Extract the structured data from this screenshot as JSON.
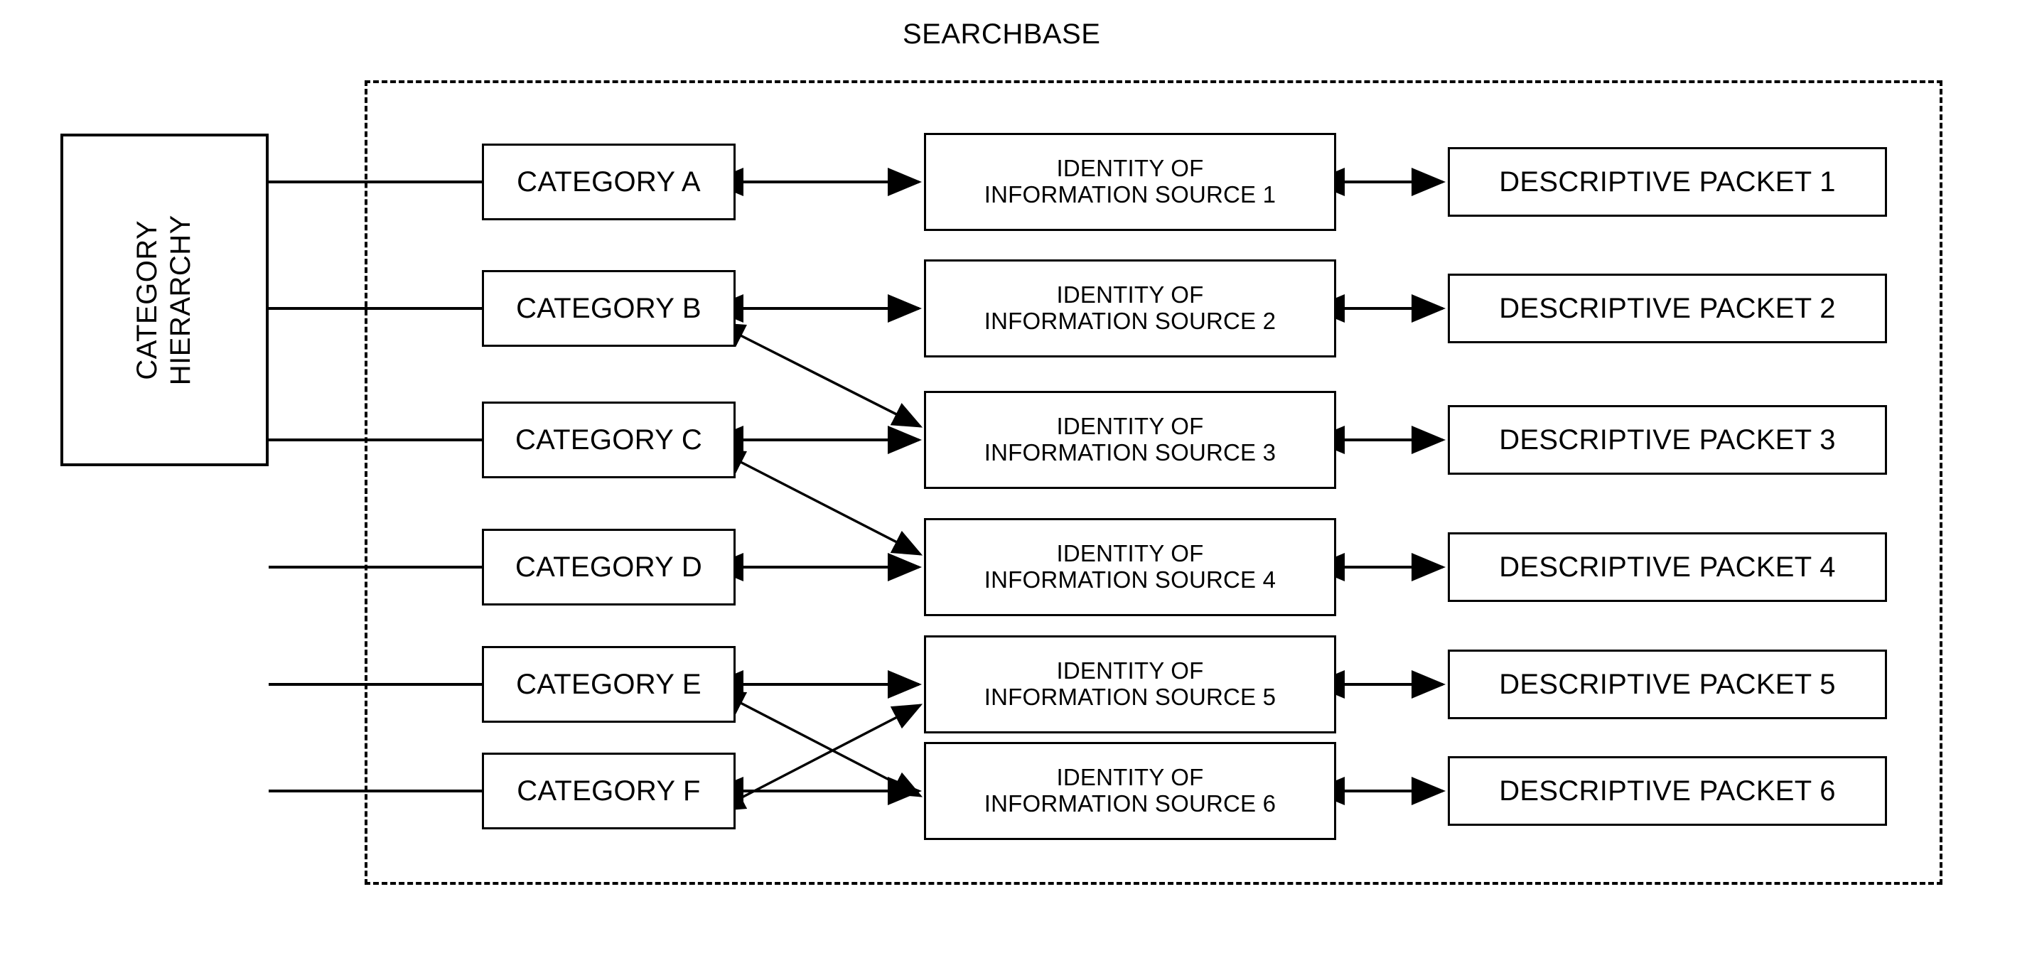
{
  "diagram": {
    "title": "SEARCHBASE",
    "hierarchy_box": {
      "label_line1": "CATEGORY",
      "label_line2": "HIERARCHY"
    },
    "categories": [
      {
        "label": "CATEGORY A"
      },
      {
        "label": "CATEGORY B"
      },
      {
        "label": "CATEGORY C"
      },
      {
        "label": "CATEGORY D"
      },
      {
        "label": "CATEGORY E"
      },
      {
        "label": "CATEGORY F"
      }
    ],
    "information_sources": [
      {
        "line1": "IDENTITY OF",
        "line2": "INFORMATION SOURCE 1"
      },
      {
        "line1": "IDENTITY OF",
        "line2": "INFORMATION SOURCE 2"
      },
      {
        "line1": "IDENTITY OF",
        "line2": "INFORMATION SOURCE 3"
      },
      {
        "line1": "IDENTITY OF",
        "line2": "INFORMATION SOURCE 4"
      },
      {
        "line1": "IDENTITY OF",
        "line2": "INFORMATION SOURCE 5"
      },
      {
        "line1": "IDENTITY OF",
        "line2": "INFORMATION SOURCE 6"
      }
    ],
    "descriptive_packets": [
      {
        "label": "DESCRIPTIVE PACKET 1"
      },
      {
        "label": "DESCRIPTIVE PACKET 2"
      },
      {
        "label": "DESCRIPTIVE PACKET 3"
      },
      {
        "label": "DESCRIPTIVE PACKET 4"
      },
      {
        "label": "DESCRIPTIVE PACKET 5"
      },
      {
        "label": "DESCRIPTIVE PACKET 6"
      }
    ],
    "colors": {
      "stroke": "#000000",
      "background": "#ffffff"
    },
    "connections": {
      "hierarchy_to_category": [
        "CATEGORY A",
        "CATEGORY B",
        "CATEGORY C",
        "CATEGORY D",
        "CATEGORY E",
        "CATEGORY F"
      ],
      "category_to_source_horizontal": [
        [
          "CATEGORY A",
          "IDENTITY OF INFORMATION SOURCE 1"
        ],
        [
          "CATEGORY B",
          "IDENTITY OF INFORMATION SOURCE 2"
        ],
        [
          "CATEGORY C",
          "IDENTITY OF INFORMATION SOURCE 3"
        ],
        [
          "CATEGORY D",
          "IDENTITY OF INFORMATION SOURCE 4"
        ],
        [
          "CATEGORY E",
          "IDENTITY OF INFORMATION SOURCE 5"
        ],
        [
          "CATEGORY F",
          "IDENTITY OF INFORMATION SOURCE 6"
        ]
      ],
      "category_to_source_diagonal": [
        [
          "CATEGORY B",
          "IDENTITY OF INFORMATION SOURCE 3"
        ],
        [
          "CATEGORY C",
          "IDENTITY OF INFORMATION SOURCE 4"
        ],
        [
          "CATEGORY E",
          "IDENTITY OF INFORMATION SOURCE 6"
        ],
        [
          "CATEGORY F",
          "IDENTITY OF INFORMATION SOURCE 5"
        ]
      ],
      "source_to_packet": [
        [
          "IDENTITY OF INFORMATION SOURCE 1",
          "DESCRIPTIVE PACKET 1"
        ],
        [
          "IDENTITY OF INFORMATION SOURCE 2",
          "DESCRIPTIVE PACKET 2"
        ],
        [
          "IDENTITY OF INFORMATION SOURCE 3",
          "DESCRIPTIVE PACKET 3"
        ],
        [
          "IDENTITY OF INFORMATION SOURCE 4",
          "DESCRIPTIVE PACKET 4"
        ],
        [
          "IDENTITY OF INFORMATION SOURCE 5",
          "DESCRIPTIVE PACKET 5"
        ],
        [
          "IDENTITY OF INFORMATION SOURCE 6",
          "DESCRIPTIVE PACKET 6"
        ]
      ]
    }
  }
}
